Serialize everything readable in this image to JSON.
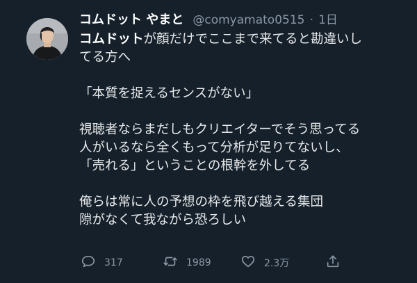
{
  "tweet": {
    "author_name": "コムドット やまと",
    "handle": "@comyamato0515",
    "separator": "·",
    "time": "1日",
    "mention": "コムドット",
    "first_line_rest": "が顔だけでここまで来てると勘違いし",
    "line2": "てる方へ",
    "line3": "「本質を捉えるセンスがない」",
    "line4": "視聴者ならまだしもクリエイターでそう思ってる",
    "line5": "人がいるなら全くもって分析が足りてないし、",
    "line6": "「売れる」ということの根幹を外してる",
    "line7": "俺らは常に人の予想の枠を飛び越える集団",
    "line8": "隙がなくて我ながら恐ろしい"
  },
  "actions": {
    "reply_count": "317",
    "retweet_count": "1989",
    "like_count": "2.3万"
  },
  "colors": {
    "background": "#15202b",
    "text": "#e7e9ea",
    "secondary": "#8b98a5"
  },
  "icons": [
    "reply-icon",
    "retweet-icon",
    "like-icon",
    "share-icon"
  ]
}
